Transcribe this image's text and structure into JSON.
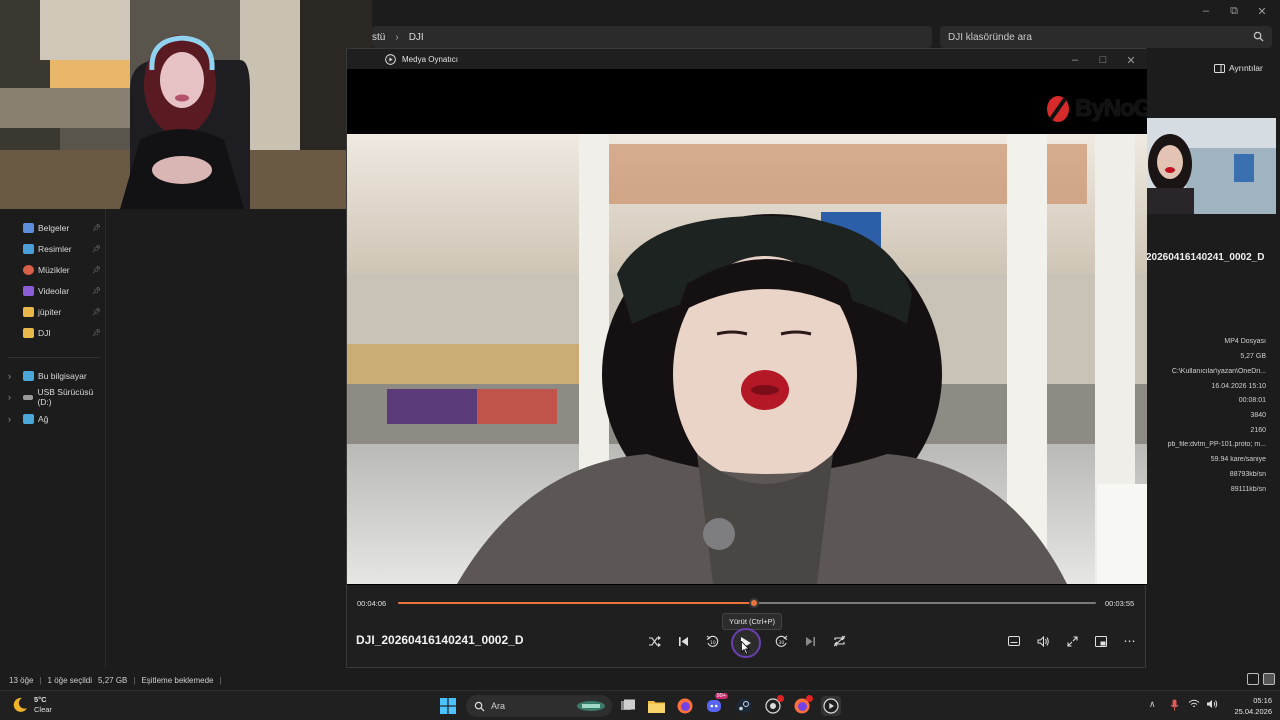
{
  "explorer": {
    "breadcrumb": [
      "stü",
      "DJI"
    ],
    "search_placeholder": "DJI klasöründe ara",
    "details_label": "Ayrıntılar",
    "sidebar": [
      {
        "label": "Belgeler",
        "icon": "documents-icon",
        "color": "#5b8fd9",
        "pinned": true
      },
      {
        "label": "Resimler",
        "icon": "pictures-icon",
        "color": "#4a9fd8",
        "pinned": true
      },
      {
        "label": "Müzikler",
        "icon": "music-icon",
        "color": "#d9604a",
        "pinned": true
      },
      {
        "label": "Videolar",
        "icon": "videos-icon",
        "color": "#8a5cd6",
        "pinned": true
      },
      {
        "label": "jüpiter",
        "icon": "folder-icon",
        "color": "#e8b84a",
        "pinned": true
      },
      {
        "label": "DJI",
        "icon": "folder-icon",
        "color": "#e8b84a",
        "pinned": true
      }
    ],
    "drives": [
      {
        "label": "Bu bilgisayar",
        "icon": "computer-icon",
        "color": "#4aa8d8"
      },
      {
        "label": "USB Sürücüsü (D:)",
        "icon": "usb-drive-icon",
        "color": "#9a9a9a"
      },
      {
        "label": "Ağ",
        "icon": "network-icon",
        "color": "#4aa8d8"
      }
    ],
    "details": {
      "filename": "20260416140241_0002_D",
      "values": [
        "MP4 Dosyası",
        "5,27 GB",
        "C:\\Kullanıcılar\\yazan\\OneDri...",
        "16.04.2026 15:10",
        "00:08:01",
        "3840",
        "2160",
        "pb_file:dvtm_PP-101.proto; m...",
        "59.94 kare/saniye",
        "88793kb/sn",
        "89111kb/sn"
      ]
    },
    "status": {
      "count": "13 öğe",
      "selected": "1 öğe seçildi",
      "size": "5,27 GB",
      "sync": "Eşitleme beklemede"
    }
  },
  "player": {
    "title": "Medya Oynatıcı",
    "watermark": "ByNoGame",
    "time_elapsed": "00:04:06",
    "time_remaining": "00:03:55",
    "progress": 0.51,
    "tooltip": "Yürüt (Ctrl+P)",
    "now_playing": "DJI_20260416140241_0002_D",
    "accent": "#e8743b"
  },
  "taskbar": {
    "weather_temp": "5°C",
    "weather_desc": "Clear",
    "search_label": "Ara",
    "time": "05:16",
    "date": "25.04.2026",
    "badge_count": "99+"
  }
}
